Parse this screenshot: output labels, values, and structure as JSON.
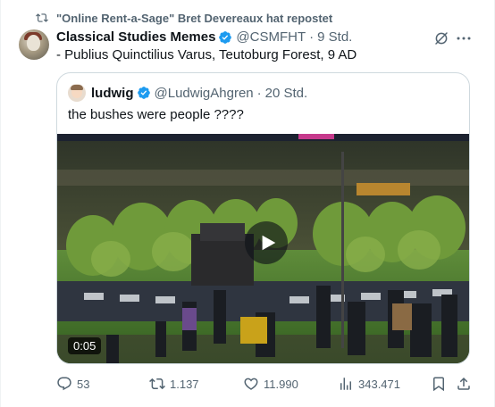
{
  "repost": {
    "text": "\"Online Rent-a-Sage\" Bret Devereaux hat repostet",
    "icon": "repost-icon"
  },
  "tweet": {
    "author_name": "Classical Studies Memes",
    "handle": "@CSMFHT",
    "separator": "·",
    "time": "9 Std.",
    "text": "- Publius Quinctilius Varus, Teutoburg Forest, 9 AD",
    "verified_color": "#1d9bf0"
  },
  "quote": {
    "author_name": "ludwig",
    "handle": "@LudwigAhgren",
    "separator": "·",
    "time": "20 Std.",
    "text": "the bushes were people ????",
    "video": {
      "duration": "0:05",
      "play_icon": "play-icon"
    }
  },
  "actions": {
    "replies": "53",
    "reposts": "1.137",
    "likes": "11.990",
    "views": "343.471"
  },
  "colors": {
    "accent": "#1d9bf0",
    "muted": "#536471",
    "border": "#cfd9de"
  }
}
